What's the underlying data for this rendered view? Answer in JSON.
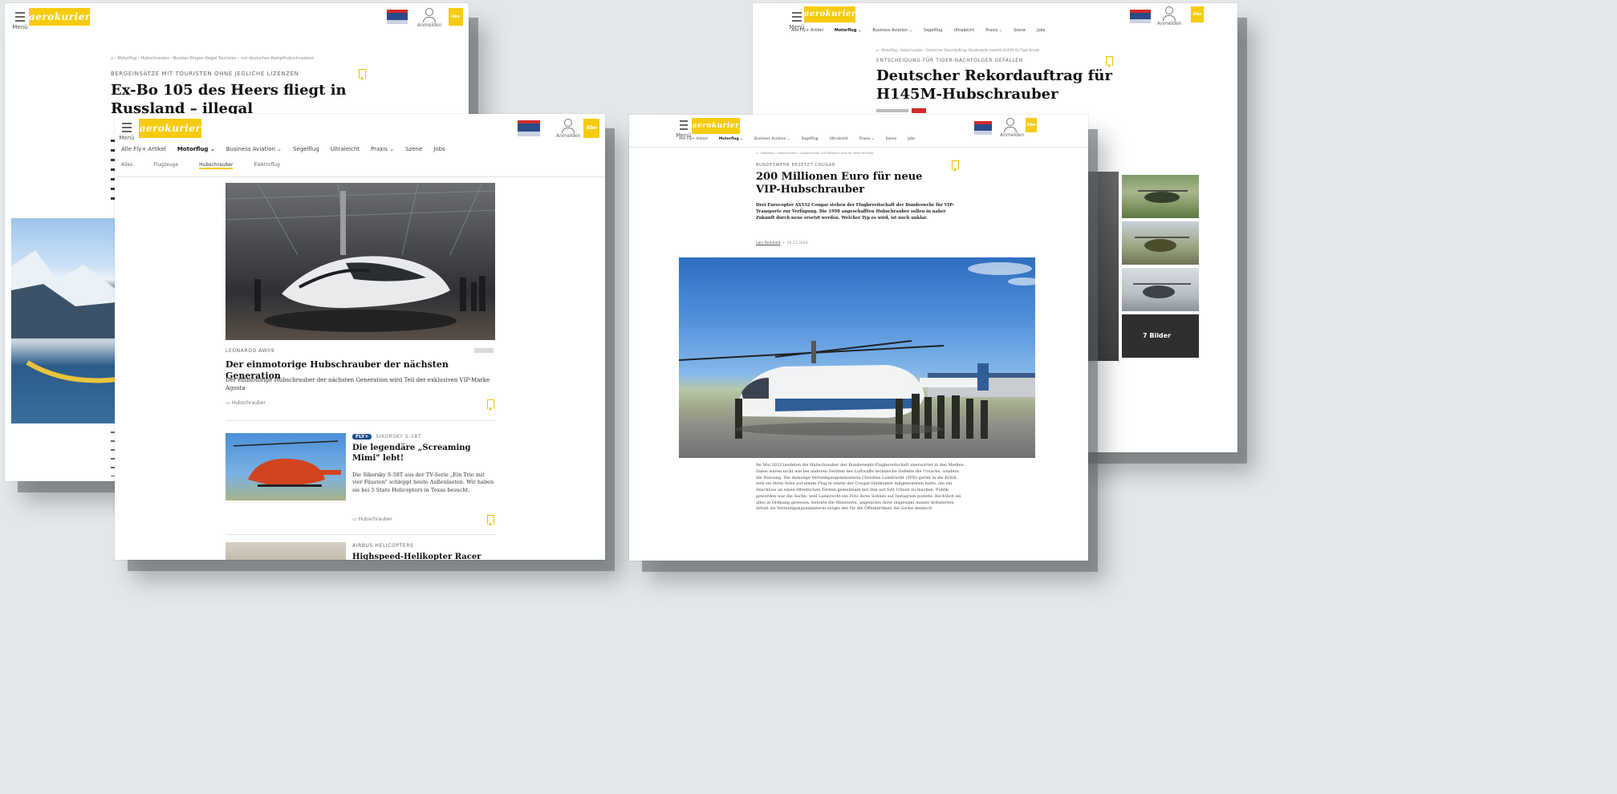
{
  "brand": {
    "logo_text": "aerokurier",
    "menu_label": "Menü",
    "account_label": "Anmelden",
    "abo_label": "Abo",
    "accent_color": "#f7cc0f"
  },
  "nav": {
    "items": [
      "Alle Fly+ Artikel",
      "Motorflug ⌄",
      "Business Aviation ⌄",
      "Segelflug",
      "Ultraleicht",
      "Praxis ⌄",
      "Szene",
      "Jobs"
    ],
    "active_index": 1
  },
  "subnav": {
    "items": [
      "Alles",
      "Flugzeuge",
      "Hubschrauber",
      "Elektroflug"
    ],
    "active_index": 2
  },
  "page1": {
    "breadcrumb": "⌂  ›  Motorflug  ›  Hubschrauber  ›  Russian Eingen illegal Touristen – mit deutschen Kampfhubschraubern",
    "kicker": "BERGEINSÄTZE MIT TOURISTEN OHNE JEGLICHE LIZENZEN",
    "title": "Ex-Bo 105 des Heers fliegt in Russland – illegal"
  },
  "page2": {
    "breadcrumb": "⌂  ›  Motorflug  ›  Hubschrauber  ›  Deutscher Rekordauftrag: Bundeswehr bestellt H145M für Tiger-Ersatz",
    "kicker": "ENTSCHEIDUNG FÜR TIGER-NACHFOLGER GEFALLEN",
    "title": "Deutscher Rekordauftrag für H145M-Hubschrauber",
    "gallery_count": "7 Bilder"
  },
  "page3": {
    "card1": {
      "kicker": "LEONARDO AW09",
      "badge": "",
      "title": "Der einmotorige Hubschrauber der nächsten Generation",
      "text": "Der einmotorige Hubschrauber der nächsten Generation wird Teil der exklusiven VIP-Marke Agusta",
      "tag": "Hubschrauber"
    },
    "card2": {
      "badge": "FLY+",
      "kicker": "SIKORSKY S-58T",
      "title": "Die legendäre „Screaming Mimi\" lebt!",
      "text": "Die Sikorsky S-58T aus der TV-Serie „Ein Trio mit vier Fäusten\" schleppt heute Außenlasten. Wir haben sie bei 5 State Helicopters in Texas besucht.",
      "tag": "Hubschrauber"
    },
    "card3": {
      "kicker": "AIRBUS HELICOPTERS",
      "title": "Highspeed-Helikopter Racer"
    }
  },
  "page4": {
    "breadcrumb": "⌂  ›  Motorflug  ›  Hubschrauber  ›  Cougar-Ersatz: 200 Millionen Euro für neue VIP-Hubs",
    "kicker": "BUNDESWEHR ERSETZT COUGAR",
    "title": "200 Millionen Euro für neue VIP-Hubschrauber",
    "lead": "Drei Eurocopter AS532 Cougar stehen der Flugbereitschaft der Bundeswehr für VIP-Transporte zur Verfügung. Die 1998 angeschafften Hubschrauber sollen in naher Zukunft durch neue ersetzt werden. Welcher Typ es wird, ist noch unklar.",
    "author": "Lars Reinhold",
    "date": "20.11.2024",
    "body": "Im Mai 2022 landeten die Hubschrauber der Bundeswehr-Flugbereitschaft unerwartet in den Medien. Dabei waren nicht wie bei anderen Geräten der Luftwaffe technische Defekte die Ursache, sondern die Nutzung. Die damalige Verteidigungsministerin Christine Lambrecht (SPD) geriet in die Kritik, weil sie ihren Sohn auf einem Flug in einem der Cougar-Helikopter mitgenommen hatte, um ein Anschluss an einen öffentlichen Termin gemeinsam mit ihm auf Sylt Urlaub zu machen. Publik geworden war die Sache, weil Lambrecht ein Foto ihres Sohnes auf Instagram postete. Rechtlich sei alles in Ordnung gewesen, betonte die Ministerin, angesichts ihrer insgesamt massiv kritisierten Arbeit als Verteidigungsministerin sorgte der für die Öffentlichkeit die Sache dennoch"
  }
}
